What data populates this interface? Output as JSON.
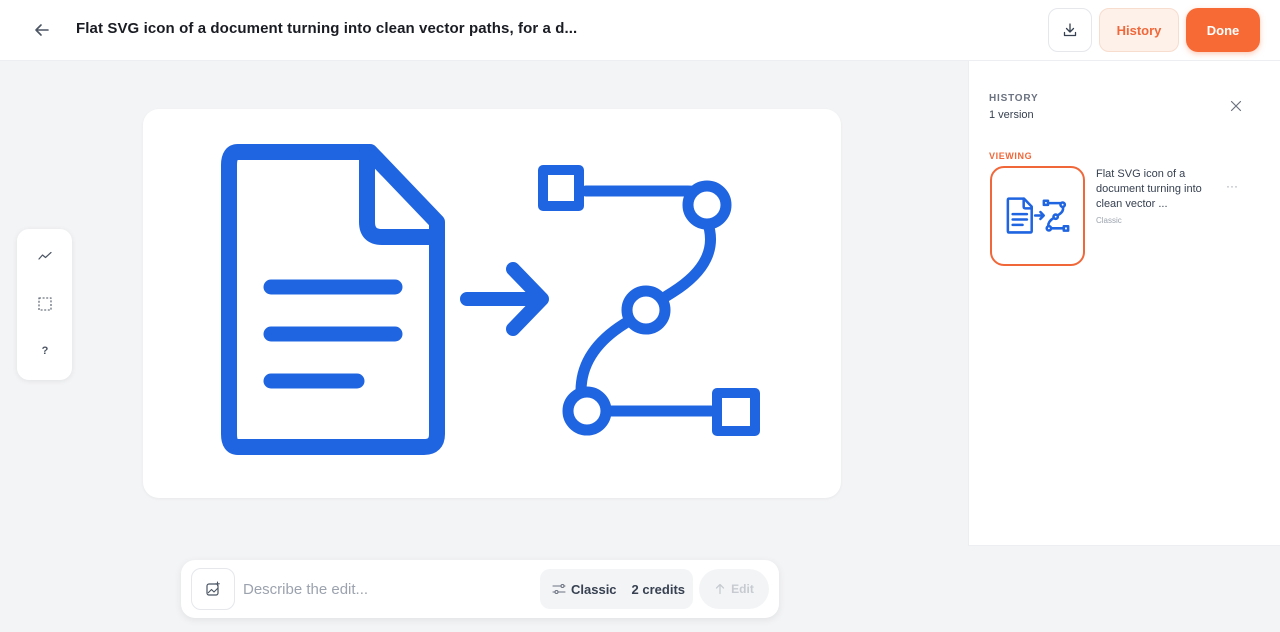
{
  "header": {
    "title": "Flat SVG icon of a document turning into clean vector paths, for a d...",
    "history_label": "History",
    "done_label": "Done"
  },
  "tools": {
    "items": [
      {
        "name": "trend-icon"
      },
      {
        "name": "select-region-icon"
      },
      {
        "name": "help-icon",
        "label": "?"
      }
    ]
  },
  "prompt": {
    "placeholder": "Describe the edit...",
    "mode": "Classic",
    "credits": "2 credits",
    "edit_label": "Edit"
  },
  "history": {
    "title": "HISTORY",
    "count": "1 version",
    "viewing": "VIEWING",
    "entries": [
      {
        "description": "Flat SVG icon of a document turning into clean vector ...",
        "style": "Classic"
      }
    ]
  },
  "colors": {
    "accent": "#f76a35",
    "icon_blue": "#1f64e0"
  }
}
